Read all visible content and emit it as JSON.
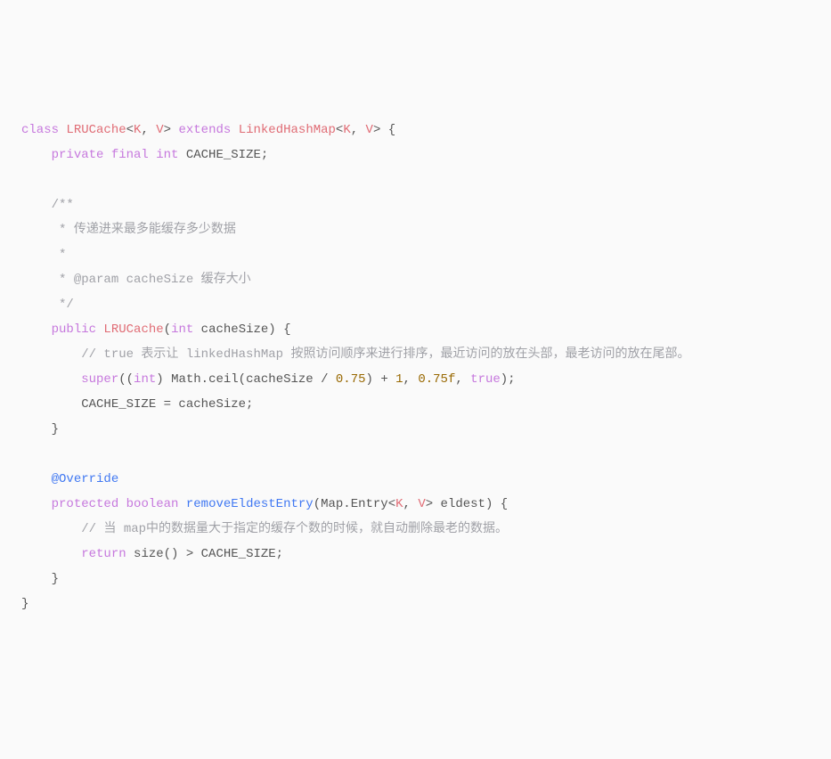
{
  "code": {
    "l1_class": "class",
    "l1_name": "LRUCache",
    "l1_lt1": "<",
    "l1_k": "K",
    "l1_c1": ", ",
    "l1_v": "V",
    "l1_gt1": ">",
    "l1_extends": " extends ",
    "l1_parent": "LinkedHashMap",
    "l1_lt2": "<",
    "l1_k2": "K",
    "l1_c2": ", ",
    "l1_v2": "V",
    "l1_gt2": ">",
    "l1_brace": " {",
    "l2_private": "private",
    "l2_final": " final ",
    "l2_int": "int",
    "l2_field": " CACHE_SIZE;",
    "l3_c1": "/**",
    "l3_c2": " * 传递进来最多能缓存多少数据",
    "l3_c3": " *",
    "l3_c4": " * @param cacheSize 缓存大小",
    "l3_c5": " */",
    "l4_public": "public",
    "l4_ctor": " LRUCache",
    "l4_paren1": "(",
    "l4_int": "int",
    "l4_param": " cacheSize",
    "l4_paren2": ")",
    "l4_brace": " {",
    "l5_cmt": "// true 表示让 linkedHashMap 按照访问顺序来进行排序，最近访问的放在头部，最老访问的放在尾部。",
    "l6_super": "super",
    "l6_p1": "((",
    "l6_int": "int",
    "l6_p2": ") Math.ceil(cacheSize / ",
    "l6_n1": "0.75",
    "l6_p3": ") + ",
    "l6_n2": "1",
    "l6_p4": ", ",
    "l6_n3": "0.75f",
    "l6_p5": ", ",
    "l6_true": "true",
    "l6_p6": ");",
    "l7_assign": "CACHE_SIZE = cacheSize;",
    "l8_close": "}",
    "l9_ann": "@Override",
    "l10_protected": "protected",
    "l10_sp1": " ",
    "l10_bool": "boolean",
    "l10_sp2": " ",
    "l10_method": "removeEldestEntry",
    "l10_p1": "(Map.Entry<",
    "l10_k": "K",
    "l10_c": ", ",
    "l10_v": "V",
    "l10_p2": "> eldest) {",
    "l11_cmt": "// 当 map中的数据量大于指定的缓存个数的时候，就自动删除最老的数据。",
    "l12_return": "return",
    "l12_expr": " size() > CACHE_SIZE;",
    "l13_close": "}",
    "l14_close": "}"
  }
}
